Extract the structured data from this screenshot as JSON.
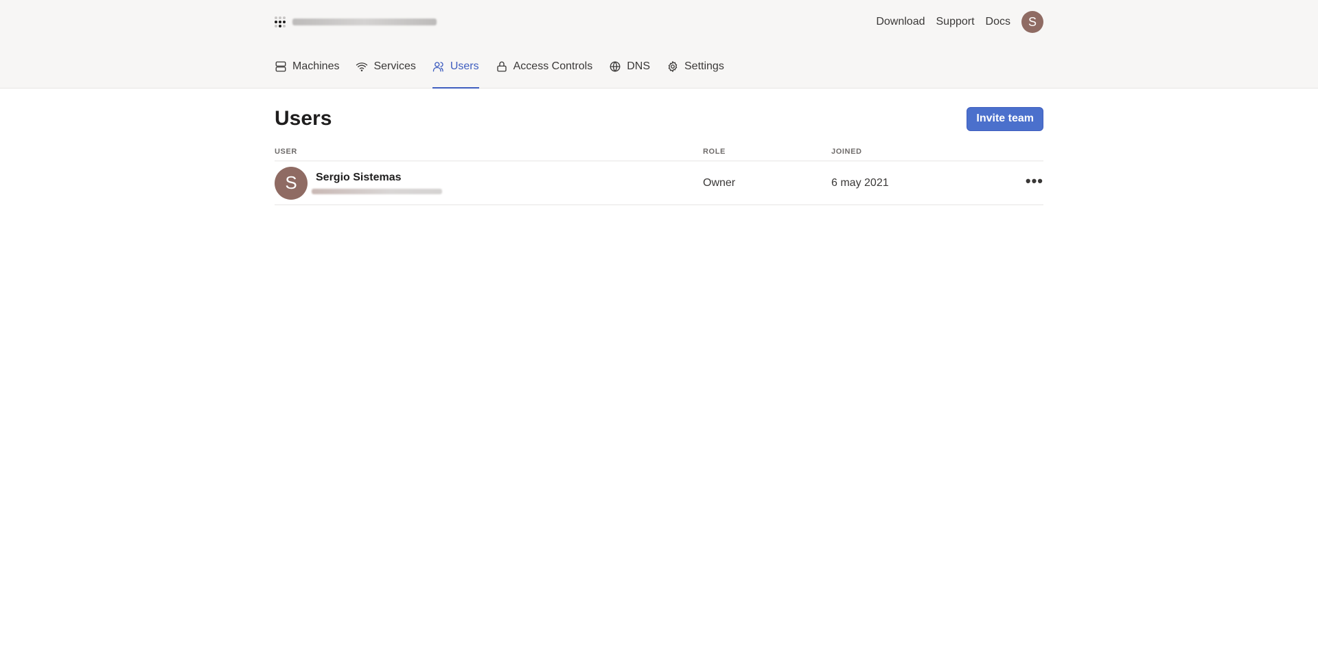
{
  "topbar": {
    "links": [
      "Download",
      "Support",
      "Docs"
    ],
    "avatar_initial": "S"
  },
  "nav": {
    "items": [
      {
        "label": "Machines",
        "icon": "server-icon"
      },
      {
        "label": "Services",
        "icon": "wifi-icon"
      },
      {
        "label": "Users",
        "icon": "users-icon",
        "active": true
      },
      {
        "label": "Access Controls",
        "icon": "lock-icon"
      },
      {
        "label": "DNS",
        "icon": "globe-icon"
      },
      {
        "label": "Settings",
        "icon": "gear-icon"
      }
    ]
  },
  "page": {
    "title": "Users",
    "invite_label": "Invite team"
  },
  "table": {
    "headers": {
      "user": "USER",
      "role": "ROLE",
      "joined": "JOINED"
    },
    "rows": [
      {
        "initial": "S",
        "name": "Sergio Sistemas",
        "role": "Owner",
        "joined": "6 may 2021",
        "actions": "•••"
      }
    ]
  },
  "colors": {
    "accent": "#3e5dbf",
    "button": "#4b70cc",
    "avatar": "#8f6b63",
    "header_bg": "#f7f6f5"
  }
}
